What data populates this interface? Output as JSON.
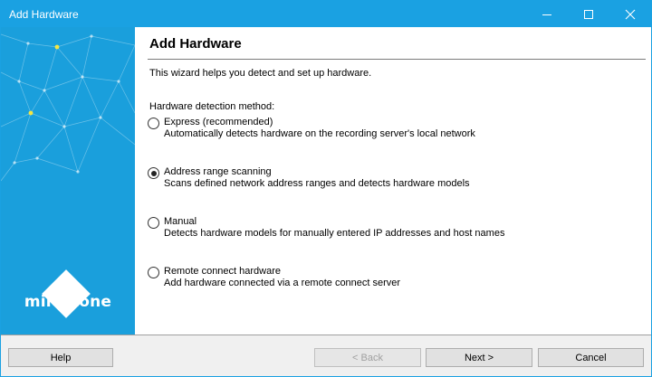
{
  "window": {
    "title": "Add Hardware"
  },
  "brand": {
    "name": "milestone"
  },
  "wizard": {
    "heading": "Add Hardware",
    "intro": "This wizard helps you detect and set up hardware.",
    "method_label": "Hardware detection method:",
    "options": [
      {
        "label": "Express (recommended)",
        "desc": "Automatically detects hardware on the recording server's local network",
        "checked": false
      },
      {
        "label": "Address range scanning",
        "desc": "Scans defined network address ranges and detects hardware models",
        "checked": true
      },
      {
        "label": "Manual",
        "desc": "Detects hardware models for manually entered IP addresses and host names",
        "checked": false
      },
      {
        "label": "Remote connect hardware",
        "desc": "Add hardware connected via a remote connect server",
        "checked": false
      }
    ]
  },
  "footer": {
    "help": "Help",
    "back": "< Back",
    "next": "Next >",
    "cancel": "Cancel"
  },
  "colors": {
    "accent": "#1aa1e2",
    "side": "#1a9fdc",
    "node": "#f5e642"
  }
}
